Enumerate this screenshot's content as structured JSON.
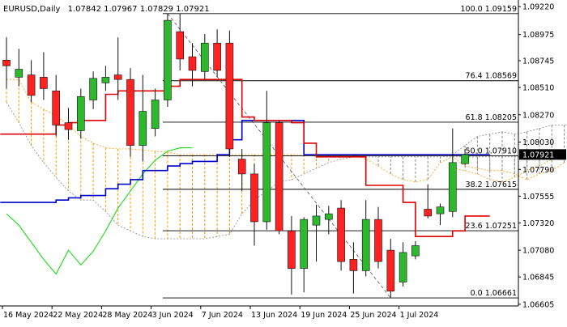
{
  "header": {
    "symbol": "EURUSD,Daily",
    "ohlc": "1.07842 1.07967 1.07829 1.07921"
  },
  "colors": {
    "bull": "#2eb82e",
    "bear": "#ff2222",
    "tenkan": "#e00000",
    "kijun": "#0000cc",
    "chikou": "#00dd00",
    "span_a": "#ff9900",
    "span_b": "#888888",
    "fib_line": "#000000",
    "price_tag_bg": "#000000",
    "price_tag_fg": "#ffffff"
  },
  "chart_data": {
    "type": "candlestick",
    "symbol": "EURUSD",
    "timeframe": "Daily",
    "ylim": [
      1.0659,
      1.0925
    ],
    "price_ticks": [
      "1.09220",
      "1.08975",
      "1.08745",
      "1.08510",
      "1.08270",
      "1.08030",
      "1.07790",
      "1.07555",
      "1.07320",
      "1.07080",
      "1.06845",
      "1.06605"
    ],
    "date_labels": [
      "16 May 2024",
      "22 May 2024",
      "28 May 2024",
      "3 Jun 2024",
      "7 Jun 2024",
      "13 Jun 2024",
      "19 Jun 2024",
      "25 Jun 2024",
      "1 Jul 2024"
    ],
    "current_price": "1.07921",
    "fib_levels": [
      {
        "label": "100.0 1.09159",
        "value": 1.09159
      },
      {
        "label": "76.4 1.08569",
        "value": 1.08569
      },
      {
        "label": "61.8 1.08205",
        "value": 1.08205
      },
      {
        "label": "50.0 1.07910",
        "value": 1.0791
      },
      {
        "label": "38.2 1.07615",
        "value": 1.07615
      },
      {
        "label": "23.6 1.07251",
        "value": 1.07251
      },
      {
        "label": "0.0 1.06661",
        "value": 1.06661
      }
    ],
    "candles": [
      {
        "o": 1.0875,
        "h": 1.0895,
        "l": 1.085,
        "c": 1.087
      },
      {
        "o": 1.086,
        "h": 1.0885,
        "l": 1.0852,
        "c": 1.0867
      },
      {
        "o": 1.0862,
        "h": 1.0875,
        "l": 1.0838,
        "c": 1.0844
      },
      {
        "o": 1.086,
        "h": 1.0882,
        "l": 1.084,
        "c": 1.085
      },
      {
        "o": 1.0848,
        "h": 1.0862,
        "l": 1.0808,
        "c": 1.0818
      },
      {
        "o": 1.082,
        "h": 1.0833,
        "l": 1.0805,
        "c": 1.0814
      },
      {
        "o": 1.0813,
        "h": 1.085,
        "l": 1.0806,
        "c": 1.0843
      },
      {
        "o": 1.084,
        "h": 1.0865,
        "l": 1.0832,
        "c": 1.0859
      },
      {
        "o": 1.0855,
        "h": 1.087,
        "l": 1.0848,
        "c": 1.086
      },
      {
        "o": 1.0862,
        "h": 1.0895,
        "l": 1.084,
        "c": 1.0858
      },
      {
        "o": 1.0858,
        "h": 1.0868,
        "l": 1.079,
        "c": 1.08
      },
      {
        "o": 1.08,
        "h": 1.0862,
        "l": 1.0786,
        "c": 1.083
      },
      {
        "o": 1.0815,
        "h": 1.085,
        "l": 1.0808,
        "c": 1.084
      },
      {
        "o": 1.084,
        "h": 1.0916,
        "l": 1.0834,
        "c": 1.091
      },
      {
        "o": 1.09,
        "h": 1.0916,
        "l": 1.0866,
        "c": 1.0876
      },
      {
        "o": 1.0878,
        "h": 1.089,
        "l": 1.0852,
        "c": 1.0866
      },
      {
        "o": 1.0865,
        "h": 1.0898,
        "l": 1.0858,
        "c": 1.089
      },
      {
        "o": 1.089,
        "h": 1.0902,
        "l": 1.086,
        "c": 1.0866
      },
      {
        "o": 1.089,
        "h": 1.0901,
        "l": 1.079,
        "c": 1.0797
      },
      {
        "o": 1.0788,
        "h": 1.0797,
        "l": 1.076,
        "c": 1.0775
      },
      {
        "o": 1.0775,
        "h": 1.0784,
        "l": 1.0712,
        "c": 1.0733
      },
      {
        "o": 1.0733,
        "h": 1.0848,
        "l": 1.0726,
        "c": 1.082
      },
      {
        "o": 1.082,
        "h": 1.0822,
        "l": 1.0722,
        "c": 1.0725
      },
      {
        "o": 1.0725,
        "h": 1.0738,
        "l": 1.0669,
        "c": 1.0692
      },
      {
        "o": 1.0692,
        "h": 1.0737,
        "l": 1.0671,
        "c": 1.0735
      },
      {
        "o": 1.073,
        "h": 1.0748,
        "l": 1.0698,
        "c": 1.0738
      },
      {
        "o": 1.0735,
        "h": 1.0747,
        "l": 1.0722,
        "c": 1.074
      },
      {
        "o": 1.0745,
        "h": 1.0752,
        "l": 1.069,
        "c": 1.0698
      },
      {
        "o": 1.07,
        "h": 1.0715,
        "l": 1.067,
        "c": 1.069
      },
      {
        "o": 1.069,
        "h": 1.0752,
        "l": 1.0685,
        "c": 1.0735
      },
      {
        "o": 1.0735,
        "h": 1.0746,
        "l": 1.0692,
        "c": 1.0698
      },
      {
        "o": 1.0708,
        "h": 1.0718,
        "l": 1.0666,
        "c": 1.0672
      },
      {
        "o": 1.068,
        "h": 1.0715,
        "l": 1.0676,
        "c": 1.0706
      },
      {
        "o": 1.0703,
        "h": 1.0716,
        "l": 1.07,
        "c": 1.0712
      },
      {
        "o": 1.0744,
        "h": 1.0766,
        "l": 1.0736,
        "c": 1.0738
      },
      {
        "o": 1.074,
        "h": 1.0749,
        "l": 1.073,
        "c": 1.0746
      },
      {
        "o": 1.0742,
        "h": 1.0815,
        "l": 1.0737,
        "c": 1.0785
      },
      {
        "o": 1.0784,
        "h": 1.0797,
        "l": 1.0783,
        "c": 1.0792
      }
    ],
    "tenkan": [
      1.081,
      1.081,
      1.081,
      1.081,
      1.0818,
      1.082,
      1.0822,
      1.0822,
      1.0845,
      1.0848,
      1.0848,
      1.0848,
      1.0848,
      1.0852,
      1.0858,
      1.0858,
      1.0858,
      1.0858,
      1.0858,
      1.0825,
      1.0822,
      1.0822,
      1.0822,
      1.082,
      1.0802,
      1.079,
      1.079,
      1.079,
      1.079,
      1.0765,
      1.0765,
      1.0765,
      1.075,
      1.072,
      1.072,
      1.072,
      1.0725,
      1.0738,
      1.0738,
      1.0738
    ],
    "kijun": [
      1.075,
      1.075,
      1.075,
      1.075,
      1.0752,
      1.0754,
      1.0756,
      1.0756,
      1.0762,
      1.0766,
      1.077,
      1.0778,
      1.0778,
      1.0782,
      1.0784,
      1.0786,
      1.0786,
      1.0792,
      1.0805,
      1.0822,
      1.0822,
      1.0822,
      1.0822,
      1.0822,
      1.0792,
      1.0792,
      1.0792,
      1.0792,
      1.0792,
      1.0792,
      1.0792,
      1.0792,
      1.0792,
      1.0792,
      1.0792,
      1.0792,
      1.0792,
      1.0792,
      1.0792,
      1.0792
    ],
    "chikou": [
      1.074,
      1.073,
      1.0715,
      1.07,
      1.0687,
      1.0708,
      1.0695,
      1.0707,
      1.0725,
      1.0745,
      1.076,
      1.0775,
      1.0787,
      1.0795,
      1.0798,
      1.0798
    ],
    "span_a": [
      1.0858,
      1.0858,
      1.0838,
      1.0832,
      1.0826,
      1.0818,
      1.0808,
      1.0802,
      1.0798,
      1.0797,
      1.0797,
      1.0796,
      1.0795,
      1.0794,
      1.0792,
      1.0792,
      1.0792,
      1.0792,
      1.0792,
      1.0792,
      1.0792,
      1.0792,
      1.0792,
      1.0792,
      1.0792,
      1.0792,
      1.0792,
      1.0792,
      1.0792,
      1.0788,
      1.0782,
      1.0775,
      1.077,
      1.0768,
      1.077,
      1.0785,
      1.079,
      1.0782,
      1.078,
      1.0778,
      1.0778,
      1.0775,
      1.077,
      1.0775,
      1.0778,
      1.0785
    ],
    "span_b": [
      1.0838,
      1.082,
      1.08,
      1.0785,
      1.0772,
      1.076,
      1.0752,
      1.0752,
      1.0742,
      1.073,
      1.0725,
      1.072,
      1.0718,
      1.0718,
      1.0718,
      1.0718,
      1.0718,
      1.072,
      1.0722,
      1.074,
      1.0752,
      1.076,
      1.0768,
      1.077,
      1.0775,
      1.078,
      1.0785,
      1.0788,
      1.079,
      1.079,
      1.079,
      1.079,
      1.079,
      1.079,
      1.079,
      1.079,
      1.079,
      1.079,
      1.079,
      1.079,
      1.079,
      1.079,
      1.079,
      1.079,
      1.079,
      1.079
    ],
    "cloud_ext_top": [
      1.0792,
      1.08,
      1.0808,
      1.081,
      1.0812,
      1.081,
      1.0812,
      1.0815,
      1.0818,
      1.0818,
      1.0817
    ],
    "cloud_ext_bottom": [
      1.078,
      1.0778,
      1.0775,
      1.077,
      1.0768,
      1.0772,
      1.0778,
      1.0782,
      1.0788,
      1.0792,
      1.0792
    ]
  }
}
